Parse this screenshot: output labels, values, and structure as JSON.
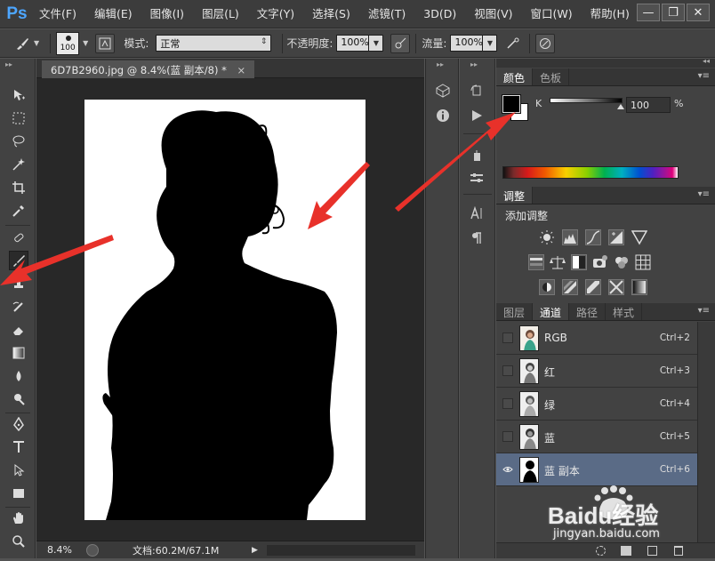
{
  "app": {
    "logo": "Ps",
    "menu": [
      "文件(F)",
      "编辑(E)",
      "图像(I)",
      "图层(L)",
      "文字(Y)",
      "选择(S)",
      "滤镜(T)",
      "3D(D)",
      "视图(V)",
      "窗口(W)",
      "帮助(H)"
    ],
    "window_controls": {
      "minimize": "—",
      "restore": "❐",
      "close": "✕"
    }
  },
  "options_bar": {
    "brush_size": "100",
    "mode_label": "模式:",
    "mode_value": "正常",
    "opacity_label": "不透明度:",
    "opacity_value": "100%",
    "flow_label": "流量:",
    "flow_value": "100%"
  },
  "document": {
    "tab_title": "6D7B2960.jpg @ 8.4%(蓝 副本/8) *",
    "close": "×",
    "zoom": "8.4%",
    "doc_size": "文档:60.2M/67.1M"
  },
  "color_panel": {
    "tabs": [
      "颜色",
      "色板"
    ],
    "active_tab": 0,
    "channel_label": "K",
    "value": "100",
    "unit": "%",
    "foreground": "#000000",
    "background": "#ffffff"
  },
  "adjustments_panel": {
    "tab": "调整",
    "heading": "添加调整"
  },
  "channels_panel": {
    "tabs": [
      "图层",
      "通道",
      "路径",
      "样式"
    ],
    "active_tab": 1,
    "channels": [
      {
        "name": "RGB",
        "shortcut": "Ctrl+2",
        "visible": false,
        "selected": false
      },
      {
        "name": "红",
        "shortcut": "Ctrl+3",
        "visible": false,
        "selected": false
      },
      {
        "name": "绿",
        "shortcut": "Ctrl+4",
        "visible": false,
        "selected": false
      },
      {
        "name": "蓝",
        "shortcut": "Ctrl+5",
        "visible": false,
        "selected": false
      },
      {
        "name": "蓝 副本",
        "shortcut": "Ctrl+6",
        "visible": true,
        "selected": true
      }
    ]
  },
  "watermark": {
    "brand": "Baidu经验",
    "url": "jingyan.baidu.com"
  },
  "colors": {
    "accent_arrow": "#e8312a",
    "selected_row": "#5a6b86",
    "ps_blue": "#4da6ff"
  }
}
